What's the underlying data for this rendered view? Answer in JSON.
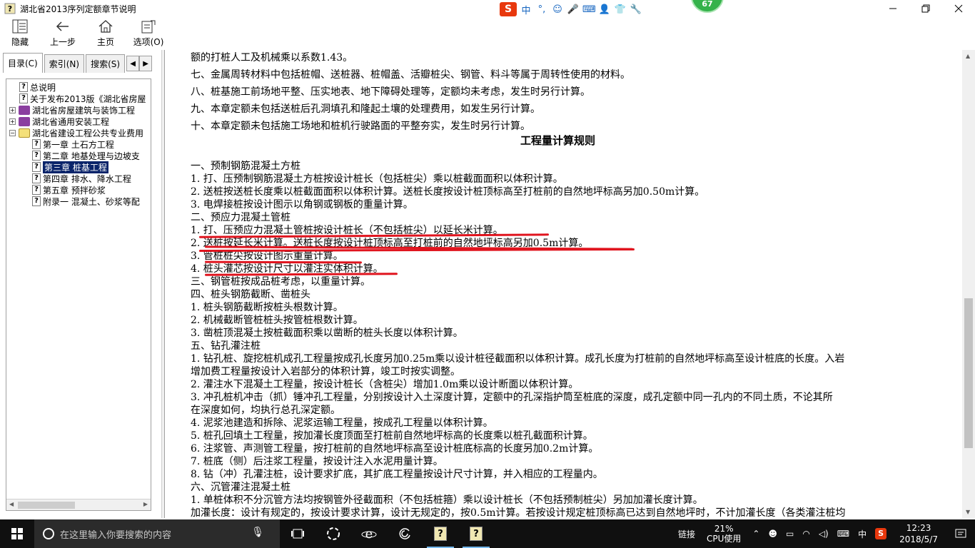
{
  "window": {
    "title": "湖北省2013序列定额章节说明"
  },
  "ime": {
    "logo": "S",
    "mode": "中",
    "items": [
      "°,",
      "☺",
      "🎤",
      "⌨",
      "👤",
      "👕",
      "🔧"
    ]
  },
  "badge": {
    "value": "67"
  },
  "toolbar": {
    "hide_label": "隐藏",
    "back_label": "上一步",
    "home_label": "主页",
    "options_label": "选项(O)"
  },
  "tabs": {
    "contents": "目录(C)",
    "index": "索引(N)",
    "search": "搜索(S)"
  },
  "tree": [
    {
      "label": "总说明",
      "indent": 1,
      "icon": "q",
      "expander": ""
    },
    {
      "label": "关于发布2013版《湖北省房屋",
      "indent": 1,
      "icon": "q",
      "expander": ""
    },
    {
      "label": "湖北省房屋建筑与装饰工程",
      "indent": 0,
      "icon": "book",
      "expander": "+"
    },
    {
      "label": "湖北省通用安装工程",
      "indent": 0,
      "icon": "book",
      "expander": "+"
    },
    {
      "label": "湖北省建设工程公共专业费用",
      "indent": 0,
      "icon": "bookopen",
      "expander": "−"
    },
    {
      "label": "第一章 土石方工程",
      "indent": 2,
      "icon": "q",
      "expander": ""
    },
    {
      "label": "第二章 地基处理与边坡支",
      "indent": 2,
      "icon": "q",
      "expander": ""
    },
    {
      "label": "第三章 桩基工程",
      "indent": 2,
      "icon": "q",
      "expander": "",
      "selected": true
    },
    {
      "label": "第四章 排水、降水工程",
      "indent": 2,
      "icon": "q",
      "expander": ""
    },
    {
      "label": "第五章 预拌砂浆",
      "indent": 2,
      "icon": "q",
      "expander": ""
    },
    {
      "label": "附录一 混凝土、砂浆等配",
      "indent": 2,
      "icon": "q",
      "expander": ""
    }
  ],
  "content": {
    "heading": "工程量计算规则",
    "lines_before": [
      "额的打桩人工及机械乘以系数1.43。",
      "七、金属周转材料中包括桩帽、送桩器、桩帽盖、活瓣桩尖、钢管、料斗等属于周转性使用的材料。",
      "八、桩基施工前场地平整、压实地表、地下障碍处理等，定额均未考虑，发生时另行计算。",
      "九、本章定额未包括送桩后孔洞填孔和隆起土壤的处理费用，如发生另行计算。",
      "十、本章定额未包括施工场地和桩机行驶路面的平整夯实，发生时另行计算。"
    ],
    "lines_after": [
      "一、预制钢筋混凝土方桩",
      "1. 打、压预制钢筋混凝土方桩按设计桩长（包括桩尖）乘以桩截面面积以体积计算。",
      "2. 送桩按送桩长度乘以桩截面面积以体积计算。送桩长度按设计桩顶标高至打桩前的自然地坪标高另加0.50m计算。",
      "3. 电焊接桩按设计图示以角钢或钢板的重量计算。",
      "二、预应力混凝土管桩",
      "1. 打、压预应力混凝土管桩按设计桩长（不包括桩尖）以延长米计算。",
      "2. 送桩按延长米计算。送桩长度按设计桩顶标高至打桩前的自然地坪标高另加0.5m计算。",
      "3. 管桩桩尖按设计图示重量计算。",
      "4. 桩头灌芯按设计尺寸以灌注实体积计算。",
      "三、钢管桩按成品桩考虑，以重量计算。",
      "四、桩头钢筋截断、凿桩头",
      "1. 桩头钢筋截断按桩头根数计算。",
      "2. 机械截断管桩桩头按管桩根数计算。",
      "3. 凿桩顶混凝土按桩截面积乘以凿断的桩头长度以体积计算。",
      "五、钻孔灌注桩",
      "1. 钻孔桩、旋挖桩机成孔工程量按成孔长度另加0.25m乘以设计桩径截面积以体积计算。成孔长度为打桩前的自然地坪标高至设计桩底的长度。入岩",
      "增加费工程量按设计入岩部分的体积计算，竣工时按实调整。",
      "2. 灌注水下混凝土工程量，按设计桩长（含桩尖）增加1.0m乘以设计断面以体积计算。",
      "3. 冲孔桩机冲击（抓）锤冲孔工程量，分别按设计入土深度计算，定额中的孔深指护筒至桩底的深度，成孔定额中同一孔内的不同土质，不论其所",
      "在深度如何，均执行总孔深定额。",
      "4. 泥浆池建造和拆除、泥浆运输工程量，按成孔工程量以体积计算。",
      "5. 桩孔回填土工程量，按加灌长度顶面至打桩前自然地坪标高的长度乘以桩孔截面积计算。",
      "6. 注浆管、声测管工程量，按打桩前的自然地坪标高至设计桩底标高的长度另加0.2m计算。",
      "7. 桩底（侧）后注浆工程量，按设计注入水泥用量计算。",
      "8. 钻（冲）孔灌注桩，设计要求扩底，其扩底工程量按设计尺寸计算，并入相应的工程量内。",
      "六、沉管灌注混凝土桩",
      "1. 单桩体积不分沉管方法均按钢管外径截面积（不包括桩箍）乘以设计桩长（不包括预制桩尖）另加加灌长度计算。",
      "加灌长度：设计有规定的，按设计要求计算，设计无规定的，按0.5m计算。若按设计规定桩顶标高已达到自然地坪时，不计加灌长度（各类灌注桩均"
    ]
  },
  "taskbar": {
    "search_placeholder": "在这里输入你要搜索的内容",
    "link_label": "链接",
    "cpu_percent": "21%",
    "cpu_label": "CPU使用",
    "ime_label": "中",
    "time": "12:23",
    "date": "2018/5/7"
  },
  "colors": {
    "selection": "#0a246a",
    "annotation_red": "#e0141e",
    "badge_green": "#34b24a",
    "taskbar": "#101010"
  }
}
